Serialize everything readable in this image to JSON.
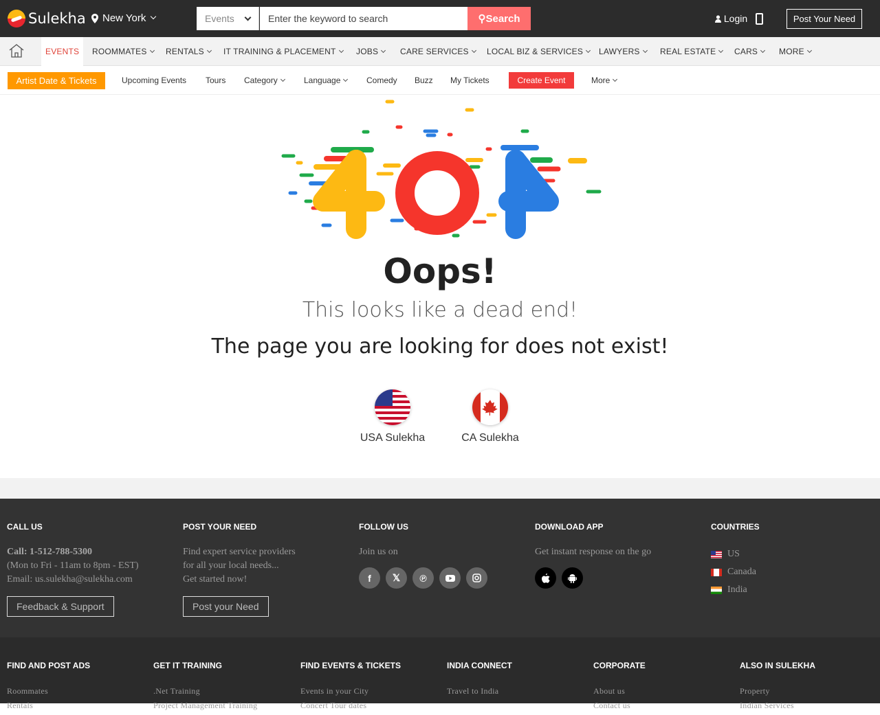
{
  "header": {
    "brand": "Sulekha",
    "city": "New York",
    "search_category": "Events",
    "search_placeholder": "Enter the keyword to search",
    "search_button": "Search",
    "login": "Login",
    "post_need": "Post Your Need"
  },
  "main_nav": [
    "EVENTS",
    "ROOMMATES",
    "RENTALS",
    "IT TRAINING & PLACEMENT",
    "JOBS",
    "CARE SERVICES",
    "LOCAL BIZ & SERVICES",
    "LAWYERS",
    "REAL ESTATE",
    "CARS",
    "MORE"
  ],
  "sub_nav": {
    "artist": "Artist Date & Tickets",
    "items": [
      "Upcoming Events",
      "Tours",
      "Category",
      "Language",
      "Comedy",
      "Buzz",
      "My Tickets"
    ],
    "create_event": "Create Event",
    "more": "More"
  },
  "error": {
    "code": "404",
    "title": "Oops!",
    "subtitle": "This looks like a dead end!",
    "message": "The page you are looking for does not exist!",
    "links": [
      "USA Sulekha",
      "CA Sulekha"
    ]
  },
  "colors": {
    "yellow": "#fdb913",
    "red": "#f5352c",
    "blue": "#2a7de1",
    "green": "#1faa4a",
    "orange": "#ff9800"
  },
  "footer": {
    "call": {
      "head": "CALL US",
      "phone": "Call: 1-512-788-5300",
      "hours": "(Mon to Fri - 11am to 8pm - EST)",
      "email": "Email: us.sulekha@sulekha.com",
      "button": "Feedback & Support"
    },
    "post": {
      "head": "POST YOUR NEED",
      "line1": "Find expert service providers",
      "line2": "for all your local needs...",
      "line3": "Get started now!",
      "button": "Post your Need"
    },
    "follow": {
      "head": "FOLLOW US",
      "text": "Join us on",
      "icons": [
        "facebook-icon",
        "x-icon",
        "pinterest-icon",
        "youtube-icon",
        "instagram-icon"
      ]
    },
    "app": {
      "head": "DOWNLOAD APP",
      "text": "Get instant response on the go",
      "icons": [
        "apple-icon",
        "android-icon"
      ]
    },
    "countries": {
      "head": "COUNTRIES",
      "items": [
        "US",
        "Canada",
        "India"
      ]
    },
    "bottom": [
      {
        "head": "FIND AND POST ADS",
        "links": [
          "Roommates",
          "Rentals"
        ]
      },
      {
        "head": "GET IT TRAINING",
        "links": [
          ".Net Training",
          "Project Management Training"
        ]
      },
      {
        "head": "FIND EVENTS & TICKETS",
        "links": [
          "Events in your City",
          "Concert Tour dates"
        ]
      },
      {
        "head": "INDIA CONNECT",
        "links": [
          "Travel to India",
          ""
        ]
      },
      {
        "head": "CORPORATE",
        "links": [
          "About us",
          "Contact us"
        ]
      },
      {
        "head": "ALSO IN SULEKHA",
        "links": [
          "Property",
          "Indian Services"
        ]
      }
    ]
  }
}
